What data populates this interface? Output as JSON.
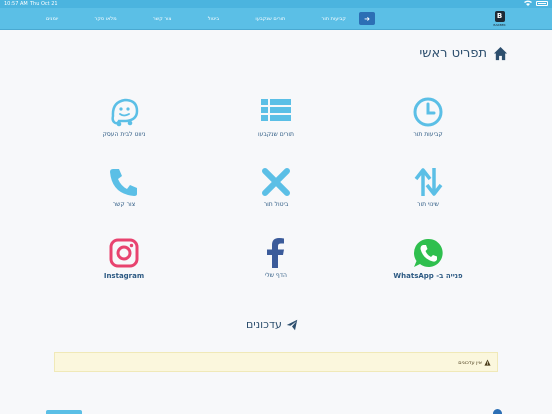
{
  "status_bar": {
    "time": "10:57 AM",
    "date": "Thu Oct 21"
  },
  "header": {
    "nav_items": [
      "קביעות תור",
      "תורים שנקבעו",
      "ביטול",
      "צור קשר",
      "מלאו סקר",
      "יומנים"
    ],
    "login_label": "➜",
    "logo_mark": "B",
    "logo_text": "BARBER"
  },
  "page_title": "תפריט ראשי",
  "tiles": [
    {
      "label": "קביעות תור",
      "icon": "clock-icon",
      "color": "#5bbfe6"
    },
    {
      "label": "תורים שנקבעו",
      "icon": "list-icon",
      "color": "#5bbfe6"
    },
    {
      "label": "ניווט לבית העסק",
      "icon": "waze-icon",
      "color": "#5bbfe6"
    },
    {
      "label": "שינוי תור",
      "icon": "swap-arrows-icon",
      "color": "#5bbfe6"
    },
    {
      "label": "ביטול תור",
      "icon": "x-icon",
      "color": "#5bbfe6"
    },
    {
      "label": "צור קשר",
      "icon": "phone-icon",
      "color": "#5bbfe6"
    },
    {
      "label": "פנייה ב- WhatsApp",
      "icon": "whatsapp-icon",
      "color": "#2fbf4e"
    },
    {
      "label": "הדף שלי",
      "icon": "facebook-icon",
      "color": "#3b5b9a"
    },
    {
      "label": "Instagram",
      "icon": "instagram-icon",
      "color": "#e8436f"
    }
  ],
  "updates": {
    "title": "עדכונים",
    "empty_text": "אין עדכונים"
  },
  "colors": {
    "accent": "#5bbfe6",
    "header": "#5bbfe6",
    "title": "#2d4f6e"
  }
}
